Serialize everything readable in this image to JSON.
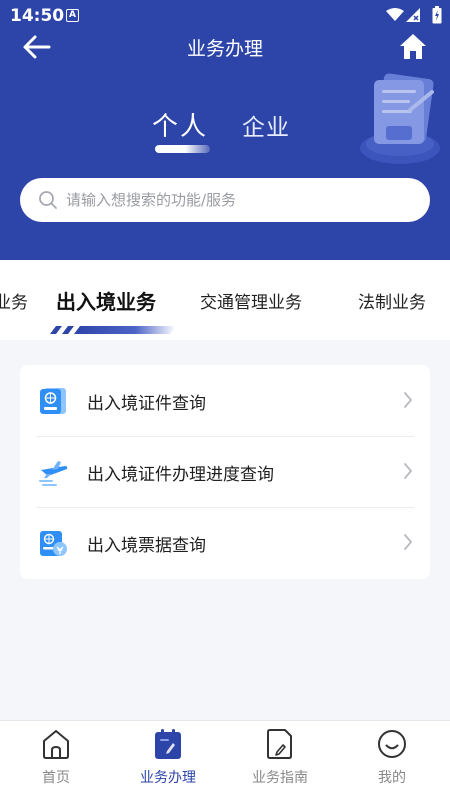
{
  "status": {
    "time": "14:50",
    "badge": "A"
  },
  "navbar": {
    "title": "业务办理",
    "back_icon": "arrow-left-icon",
    "home_icon": "home-icon"
  },
  "segments": {
    "personal": "个人",
    "enterprise": "企业"
  },
  "search": {
    "placeholder": "请输入想搜索的功能/服务"
  },
  "tabs": [
    {
      "label": "业务"
    },
    {
      "label": "出入境业务"
    },
    {
      "label": "交通管理业务"
    },
    {
      "label": "法制业务"
    }
  ],
  "services": [
    {
      "label": "出入境证件查询",
      "icon": "passport-icon"
    },
    {
      "label": "出入境证件办理进度查询",
      "icon": "airplane-icon"
    },
    {
      "label": "出入境票据查询",
      "icon": "receipt-icon"
    }
  ],
  "tabbar": [
    {
      "label": "首页",
      "icon": "home-outline-icon"
    },
    {
      "label": "业务办理",
      "icon": "business-icon"
    },
    {
      "label": "业务指南",
      "icon": "guide-icon"
    },
    {
      "label": "我的",
      "icon": "smiley-icon"
    }
  ],
  "colors": {
    "primary": "#2d44a8",
    "background": "#f5f6fa",
    "inactive": "#888888"
  }
}
